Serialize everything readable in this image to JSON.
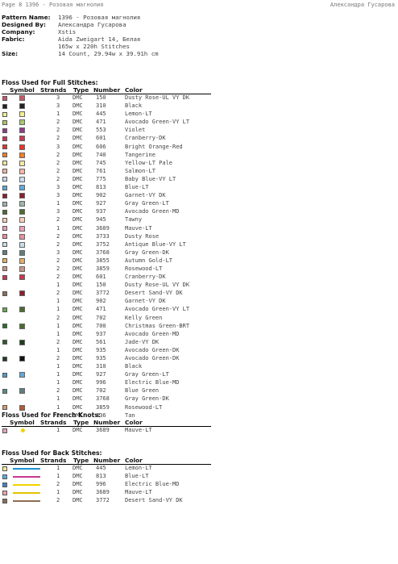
{
  "header": {
    "left": "Page 8  1396 - Розовая магнолия",
    "right": "Александра Гусарова"
  },
  "meta": [
    {
      "k": "Pattern Name:",
      "v": "1396 - Розовая магнолия"
    },
    {
      "k": "Designed By:",
      "v": "Александра Гусарова"
    },
    {
      "k": "Company:",
      "v": "Xstis"
    },
    {
      "k": "Fabric:",
      "v": "Aida Zweigart 14, Белая"
    },
    {
      "k": "",
      "v": "165w x 220h Stitches"
    },
    {
      "k": "Size:",
      "v": "14 Count,   29.94w x 39.91h cm"
    }
  ],
  "sections": {
    "full": "Floss Used for Full Stitches:",
    "knots": "Floss Used for French Knots:",
    "back": "Floss Used for Back Stitches:"
  },
  "columns": {
    "symbol": "Symbol",
    "strands": "Strands",
    "type": "Type",
    "number": "Number",
    "color": "Color"
  },
  "full": [
    {
      "sw": "#c9576a",
      "sy": "#c9576a",
      "st": "3",
      "ty": "DMC",
      "nu": "150",
      "co": "Dusty Rose-UL VY DK"
    },
    {
      "sw": "#222222",
      "sy": "#222222",
      "st": "3",
      "ty": "DMC",
      "nu": "310",
      "co": "Black"
    },
    {
      "sw": "#f1ef8f",
      "sy": "#f1ef8f",
      "st": "1",
      "ty": "DMC",
      "nu": "445",
      "co": "Lemon-LT"
    },
    {
      "sw": "#a8c76b",
      "sy": "#a8c76b",
      "st": "2",
      "ty": "DMC",
      "nu": "471",
      "co": "Avocado Green-VY LT"
    },
    {
      "sw": "#8c3d8a",
      "sy": "#8c3d8a",
      "st": "2",
      "ty": "DMC",
      "nu": "553",
      "co": "Violet"
    },
    {
      "sw": "#c43a50",
      "sy": "#c43a50",
      "st": "2",
      "ty": "DMC",
      "nu": "601",
      "co": "Cranberry-DK"
    },
    {
      "sw": "#e8332a",
      "sy": "#e8332a",
      "st": "3",
      "ty": "DMC",
      "nu": "606",
      "co": "Bright Orange-Red"
    },
    {
      "sw": "#f07f26",
      "sy": "#f07f26",
      "st": "2",
      "ty": "DMC",
      "nu": "740",
      "co": "Tangerine"
    },
    {
      "sw": "#f8e6a0",
      "sy": "#f8e6a0",
      "st": "2",
      "ty": "DMC",
      "nu": "745",
      "co": "Yellow-LT Pale"
    },
    {
      "sw": "#f6b4a4",
      "sy": "#f6b4a4",
      "st": "2",
      "ty": "DMC",
      "nu": "761",
      "co": "Salmon-LT"
    },
    {
      "sw": "#c9dcf0",
      "sy": "#c9dcf0",
      "st": "2",
      "ty": "DMC",
      "nu": "775",
      "co": "Baby Blue-VY LT"
    },
    {
      "sw": "#62a8d8",
      "sy": "#62a8d8",
      "st": "3",
      "ty": "DMC",
      "nu": "813",
      "co": "Blue-LT"
    },
    {
      "sw": "#8a1f30",
      "sy": "#8a1f30",
      "st": "3",
      "ty": "DMC",
      "nu": "902",
      "co": "Garnet-VY DK"
    },
    {
      "sw": "#a0b5a8",
      "sy": "#a0b5a8",
      "st": "1",
      "ty": "DMC",
      "nu": "927",
      "co": "Gray Green-LT"
    },
    {
      "sw": "#4d6b2e",
      "sy": "#4d6b2e",
      "st": "3",
      "ty": "DMC",
      "nu": "937",
      "co": "Avocado Green-MD"
    },
    {
      "sw": "#f7d0b5",
      "sy": "#f7d0b5",
      "st": "2",
      "ty": "DMC",
      "nu": "945",
      "co": "Tawny"
    },
    {
      "sw": "#e8a3b5",
      "sy": "#e8a3b5",
      "st": "1",
      "ty": "DMC",
      "nu": "3689",
      "co": "Mauve-LT"
    },
    {
      "sw": "#e6909f",
      "sy": "#e6909f",
      "st": "2",
      "ty": "DMC",
      "nu": "3733",
      "co": "Dusty Rose"
    },
    {
      "sw": "#c6dfe8",
      "sy": "#c6dfe8",
      "st": "2",
      "ty": "DMC",
      "nu": "3752",
      "co": "Antique Blue-VY LT"
    },
    {
      "sw": "#607d80",
      "sy": "#607d80",
      "st": "3",
      "ty": "DMC",
      "nu": "3768",
      "co": "Gray Green-DK"
    },
    {
      "sw": "#e2b069",
      "sy": "#e2b069",
      "st": "2",
      "ty": "DMC",
      "nu": "3855",
      "co": "Autumn Gold-LT"
    },
    {
      "sw": "#c59886",
      "sy": "#c59886",
      "st": "2",
      "ty": "DMC",
      "nu": "3859",
      "co": "Rosewood-LT"
    },
    {
      "sw": "#c43a50",
      "sy": "#c43a50",
      "st": "2",
      "ty": "DMC",
      "nu": "601",
      "co": "Cranberry-DK"
    },
    {
      "sw": "",
      "sy": "",
      "st": "1",
      "ty": "DMC",
      "nu": "150",
      "co": "Dusty Rose-UL VY DK"
    },
    {
      "sw": "#8b6e55",
      "sy": "#8a1f30",
      "st": "2",
      "ty": "DMC",
      "nu": "3772",
      "co": "Desert Sand-VY DK"
    },
    {
      "sw": "",
      "sy": "",
      "st": "1",
      "ty": "DMC",
      "nu": "902",
      "co": "Garnet-VY DK"
    },
    {
      "sw": "#6aa84f",
      "sy": "#4d6b2e",
      "st": "1",
      "ty": "DMC",
      "nu": "471",
      "co": "Avocado Green-VY LT"
    },
    {
      "sw": "",
      "sy": "",
      "st": "2",
      "ty": "DMC",
      "nu": "702",
      "co": "Kelly Green"
    },
    {
      "sw": "#2f6b2a",
      "sy": "#4d6b2e",
      "st": "1",
      "ty": "DMC",
      "nu": "700",
      "co": "Christmas Green-BRT"
    },
    {
      "sw": "",
      "sy": "",
      "st": "1",
      "ty": "DMC",
      "nu": "937",
      "co": "Avocado Green-MD"
    },
    {
      "sw": "#2f5a2c",
      "sy": "#1f3d1e",
      "st": "2",
      "ty": "DMC",
      "nu": "561",
      "co": "Jade-VY DK"
    },
    {
      "sw": "",
      "sy": "",
      "st": "1",
      "ty": "DMC",
      "nu": "935",
      "co": "Avocado Green-DK"
    },
    {
      "sw": "#263a24",
      "sy": "#111111",
      "st": "2",
      "ty": "DMC",
      "nu": "935",
      "co": "Avocado Green-DK"
    },
    {
      "sw": "",
      "sy": "",
      "st": "1",
      "ty": "DMC",
      "nu": "310",
      "co": "Black"
    },
    {
      "sw": "#4f9ac7",
      "sy": "#62a8d8",
      "st": "1",
      "ty": "DMC",
      "nu": "927",
      "co": "Gray Green-LT"
    },
    {
      "sw": "",
      "sy": "",
      "st": "1",
      "ty": "DMC",
      "nu": "996",
      "co": "Electric Blue-MD"
    },
    {
      "sw": "#5b8c8a",
      "sy": "#607d80",
      "st": "2",
      "ty": "DMC",
      "nu": "702",
      "co": "Blue Green"
    },
    {
      "sw": "",
      "sy": "",
      "st": "1",
      "ty": "DMC",
      "nu": "3768",
      "co": "Gray Green-DK"
    },
    {
      "sw": "#d89a6a",
      "sy": "#b05a3a",
      "st": "1",
      "ty": "DMC",
      "nu": "3859",
      "co": "Rosewood-LT"
    },
    {
      "sw": "",
      "sy": "",
      "st": "2",
      "ty": "DMC",
      "nu": "436",
      "co": "Tan"
    }
  ],
  "knots": [
    {
      "sw": "#e8a3b5",
      "dot": "#f2d200",
      "st": "1",
      "ty": "DMC",
      "nu": "3689",
      "co": "Mauve-LT"
    }
  ],
  "back": [
    {
      "sw": "#f1ef8f",
      "line": "#1d8fd0",
      "st": "1",
      "ty": "DMC",
      "nu": "445",
      "co": "Lemon-LT"
    },
    {
      "sw": "#62a8d8",
      "line": "#c93a8a",
      "st": "1",
      "ty": "DMC",
      "nu": "813",
      "co": "Blue-LT"
    },
    {
      "sw": "#3d84c6",
      "line": "#f2d200",
      "st": "2",
      "ty": "DMC",
      "nu": "996",
      "co": "Electric Blue-MD"
    },
    {
      "sw": "#e8a3b5",
      "line": "#e2c400",
      "st": "1",
      "ty": "DMC",
      "nu": "3689",
      "co": "Mauve-LT"
    },
    {
      "sw": "#8b6e55",
      "line": "#8b6e55",
      "st": "2",
      "ty": "DMC",
      "nu": "3772",
      "co": "Desert Sand-VY DK"
    }
  ]
}
